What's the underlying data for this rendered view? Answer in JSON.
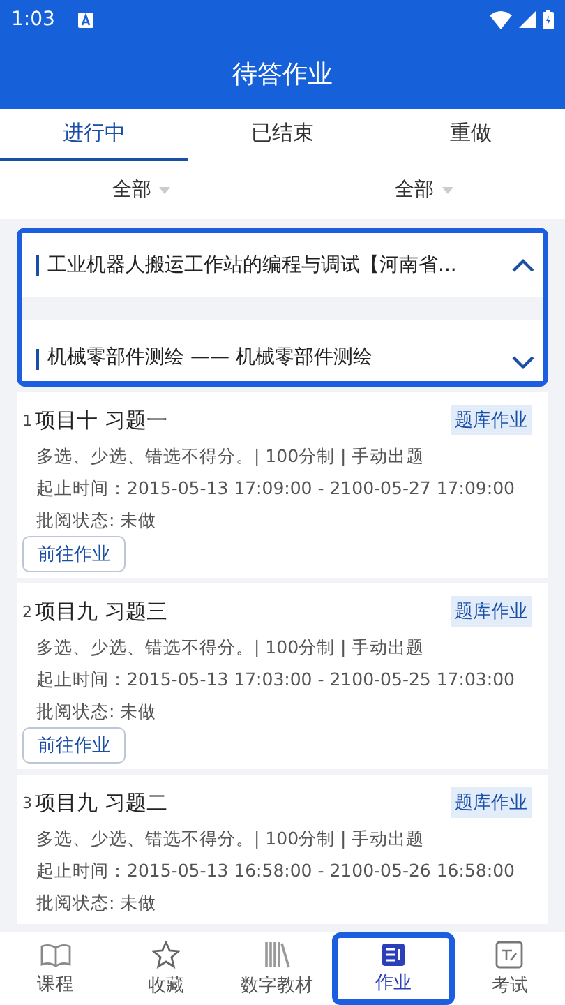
{
  "status_bar": {
    "time": "1:03"
  },
  "title": "待答作业",
  "tabs": [
    {
      "label": "进行中",
      "selected": true
    },
    {
      "label": "已结束",
      "selected": false
    },
    {
      "label": "重做",
      "selected": false
    }
  ],
  "filters": [
    {
      "label": "全部"
    },
    {
      "label": "全部"
    }
  ],
  "courses": [
    {
      "name": "工业机器人搬运工作站的编程与调试【河南省...",
      "expanded": true
    },
    {
      "name": "机械零部件测绘 —— 机械零部件测绘",
      "expanded": false
    }
  ],
  "assignments": [
    {
      "index": "1",
      "title": "项目十 习题一",
      "tag": "题库作业",
      "rules": "多选、少选、错选不得分。| 100分制 | 手动出题",
      "time": "起止时间：2015-05-13 17:09:00 - 2100-05-27 17:09:00",
      "status": "批阅状态: 未做",
      "button": "前往作业"
    },
    {
      "index": "2",
      "title": "项目九 习题三",
      "tag": "题库作业",
      "rules": "多选、少选、错选不得分。| 100分制 | 手动出题",
      "time": "起止时间：2015-05-13 17:03:00 - 2100-05-25 17:03:00",
      "status": "批阅状态: 未做",
      "button": "前往作业"
    },
    {
      "index": "3",
      "title": "项目九 习题二",
      "tag": "题库作业",
      "rules": "多选、少选、错选不得分。| 100分制 | 手动出题",
      "time": "起止时间：2015-05-13 16:58:00 - 2100-05-26 16:58:00",
      "status": "批阅状态: 未做"
    }
  ],
  "nav": [
    {
      "label": "课程",
      "kind": "book",
      "selected": false
    },
    {
      "label": "收藏",
      "kind": "star",
      "selected": false
    },
    {
      "label": "数字教材",
      "kind": "books",
      "selected": false
    },
    {
      "label": "作业",
      "kind": "homework",
      "selected": true
    },
    {
      "label": "考试",
      "kind": "exam",
      "selected": false
    }
  ]
}
